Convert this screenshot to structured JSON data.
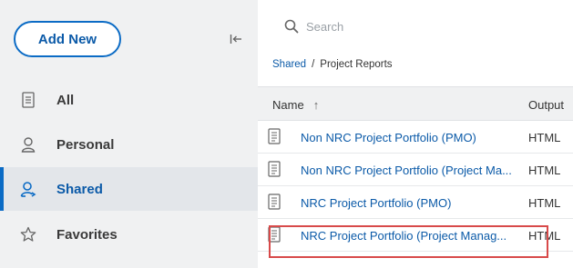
{
  "sidebar": {
    "add_new_label": "Add New",
    "collapse_icon": "collapse-left-icon",
    "items": [
      {
        "label": "All",
        "icon": "document-icon"
      },
      {
        "label": "Personal",
        "icon": "person-icon"
      },
      {
        "label": "Shared",
        "icon": "shared-person-icon",
        "active": true
      },
      {
        "label": "Favorites",
        "icon": "star-icon"
      }
    ]
  },
  "search": {
    "placeholder": "Search",
    "value": ""
  },
  "breadcrumb": {
    "root": "Shared",
    "separator": "/",
    "current": "Project Reports"
  },
  "table": {
    "columns": {
      "name": "Name",
      "sort_indicator": "↑",
      "output": "Output"
    },
    "rows": [
      {
        "name": "Non NRC Project Portfolio (PMO)",
        "output": "HTML"
      },
      {
        "name": "Non NRC Project Portfolio (Project Ma...",
        "output": "HTML"
      },
      {
        "name": "NRC Project Portfolio (PMO)",
        "output": "HTML"
      },
      {
        "name": "NRC Project Portfolio (Project Manag...",
        "output": "HTML",
        "highlighted": true
      }
    ]
  },
  "colors": {
    "accent": "#0b6bc5",
    "link": "#0b5aa8",
    "sidebar_bg": "#f0f1f2",
    "highlight_border": "#d84a4a"
  }
}
